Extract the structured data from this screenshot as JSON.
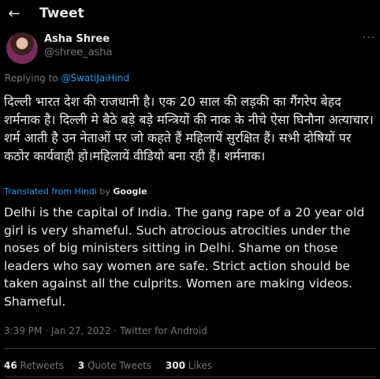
{
  "header": {
    "back_icon": "arrow-left-icon",
    "title": "Tweet"
  },
  "author": {
    "name": "Asha Shree",
    "handle": "@shree_asha",
    "more_icon": "more-horizontal-icon"
  },
  "reply": {
    "prefix": "Replying to",
    "to": "@SwatiJaiHind"
  },
  "tweet": {
    "hindi_text": "दिल्ली भारत देश की राजधानी है। एक 20 साल की लड़की का गैंगरेप बेहद शर्मनाक है। दिल्ली मे बैठे बड़े बड़े मन्त्रियों की नाक के नीचे ऐसा घिनौना अत्याचार।शर्म आती है उन नेताओं पर जो कहते हैं महिलायें सुरक्षित हैं। सभी दोषियों पर कठोर कार्यवाही हो।महिलायें वीडियो बना रही हैं। शर्मनाक।",
    "translated_label": "Translated from Hindi",
    "translated_by": "by",
    "translator": "Google",
    "english_text": "Delhi is the capital of India. The gang rape of a 20 year old girl is very shameful. Such atrocious atrocities under the noses of big ministers sitting in Delhi. Shame on those leaders who say women are safe. Strict action should be taken against all the culprits. Women are making videos. Shameful."
  },
  "meta": {
    "time": "3:39 PM",
    "sep": "·",
    "date": "Jan 27, 2022",
    "sep2": "·",
    "source": "Twitter for Android"
  },
  "stats": {
    "retweets_count": "46",
    "retweets_label": "Retweets",
    "quotes_count": "3",
    "quotes_label": "Quote Tweets",
    "likes_count": "300",
    "likes_label": "Likes"
  },
  "colors": {
    "background": "#000000",
    "text": "#e7e9ea",
    "muted": "#71767b",
    "accent": "#1d9bf0"
  }
}
